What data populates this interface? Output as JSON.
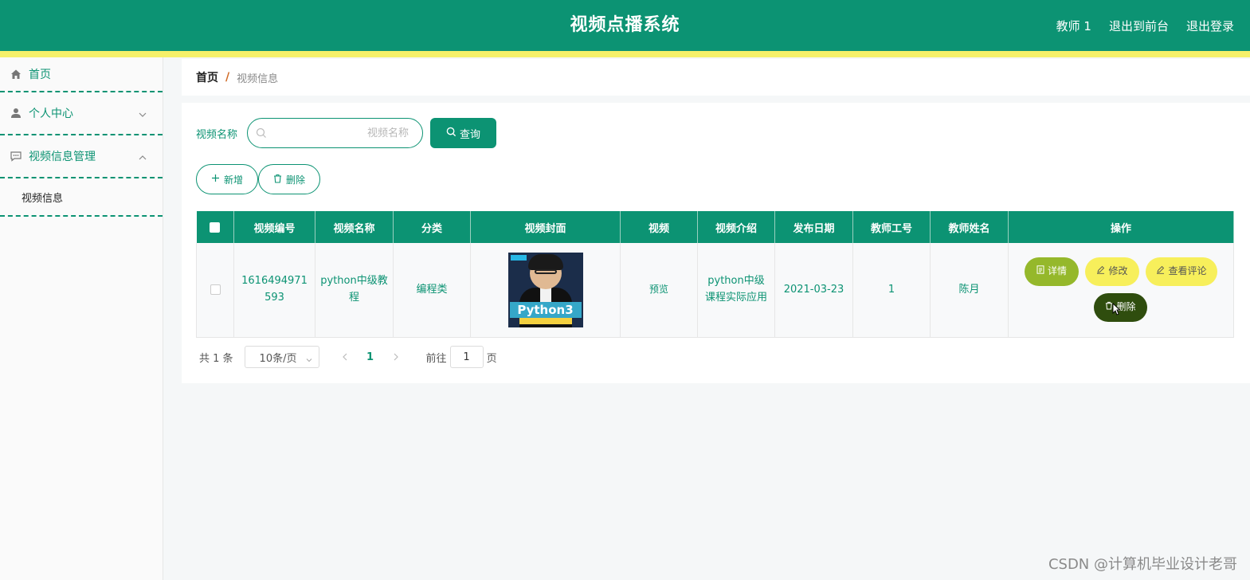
{
  "header": {
    "title": "视频点播系统",
    "user": "教师 1",
    "frontend_link": "退出到前台",
    "logout": "退出登录",
    "bg_color": "#0c9373",
    "strip_color": "#f5f06a"
  },
  "sidebar": {
    "items": [
      {
        "label": "首页",
        "icon": "home-icon"
      },
      {
        "label": "个人中心",
        "icon": "user-icon",
        "chevron": "chevron-down-icon"
      },
      {
        "label": "视频信息管理",
        "icon": "chat-icon",
        "chevron": "chevron-up-icon"
      }
    ],
    "submenu": {
      "label": "视频信息"
    }
  },
  "breadcrumb": {
    "home": "首页",
    "separator": "/",
    "current": "视频信息"
  },
  "search": {
    "label": "视频名称",
    "placeholder": "视频名称",
    "value": "",
    "button": "查询"
  },
  "actions": {
    "add": "新增",
    "delete": "删除"
  },
  "table": {
    "columns": [
      "视频编号",
      "视频名称",
      "分类",
      "视频封面",
      "视频",
      "视频介绍",
      "发布日期",
      "教师工号",
      "教师姓名",
      "操作"
    ],
    "rows": [
      {
        "video_no": "1616494971593",
        "video_name": "python中级教程",
        "category": "编程类",
        "cover_text": "Python3",
        "video": "预览",
        "intro": "python中级课程实际应用",
        "publish_date": "2021-03-23",
        "teacher_no": "1",
        "teacher_name": "陈月",
        "ops": {
          "detail": "详情",
          "edit": "修改",
          "comments": "查看评论",
          "delete": "删除"
        }
      }
    ]
  },
  "pagination": {
    "total": "共 1 条",
    "page_size": "10条/页",
    "current_page": "1",
    "goto_label": "前往",
    "goto_value": "1",
    "page_suffix": "页"
  },
  "watermark": "CSDN @计算机毕业设计老哥"
}
